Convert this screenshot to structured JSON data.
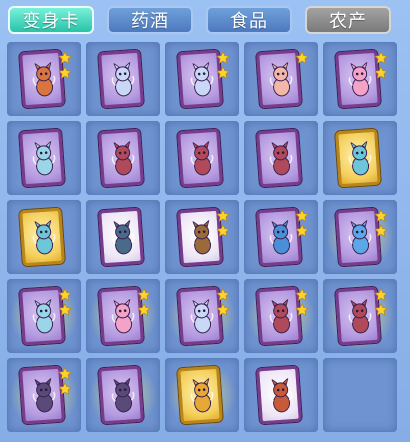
{
  "tabs": [
    {
      "label": "变身卡",
      "state": "active"
    },
    {
      "label": "药酒",
      "state": "inactive"
    },
    {
      "label": "食品",
      "state": "inactive"
    },
    {
      "label": "农产",
      "state": "gray"
    }
  ],
  "colors": {
    "active_tab": "#28c3a8",
    "inactive_tab": "#4d79bf",
    "gray_tab": "#7a7a7a",
    "slot": "#6f93d0",
    "purple_frame": "#7a3b8d",
    "gold_frame": "#b98617",
    "star": "#ffd42a"
  },
  "inventory": [
    {
      "icon": "fox-spirit-card",
      "frame": "purple",
      "stars": 2,
      "glow": false,
      "color": "#d9753f"
    },
    {
      "icon": "white-horse-card",
      "frame": "purple",
      "stars": 0,
      "glow": false,
      "color": "#c9d8f7"
    },
    {
      "icon": "white-horse-card",
      "frame": "purple",
      "stars": 2,
      "glow": false,
      "color": "#c9d8f7"
    },
    {
      "icon": "pig-card",
      "frame": "purple",
      "stars": 1,
      "glow": false,
      "color": "#f2b7a6"
    },
    {
      "icon": "rabbit-spirit-card",
      "frame": "purple",
      "stars": 2,
      "glow": false,
      "color": "#f3a2c8"
    },
    {
      "icon": "fairy-card",
      "frame": "purple",
      "stars": 0,
      "glow": false,
      "color": "#9ad6e8"
    },
    {
      "icon": "bat-demon-card",
      "frame": "purple",
      "stars": 0,
      "glow": false,
      "color": "#b04a5a"
    },
    {
      "icon": "bat-demon-card",
      "frame": "purple",
      "stars": 0,
      "glow": false,
      "color": "#b04a5a"
    },
    {
      "icon": "bat-demon-card",
      "frame": "purple",
      "stars": 0,
      "glow": false,
      "color": "#b04a5a"
    },
    {
      "icon": "fairy-girl-card",
      "frame": "gold",
      "stars": 0,
      "glow": false,
      "color": "#6cc7d8"
    },
    {
      "icon": "fairy-girl-card",
      "frame": "gold",
      "stars": 0,
      "glow": false,
      "color": "#6cc7d8"
    },
    {
      "icon": "armored-warrior-card",
      "frame": "white",
      "stars": 0,
      "glow": false,
      "color": "#4a6a8a"
    },
    {
      "icon": "bear-card",
      "frame": "white",
      "stars": 2,
      "glow": false,
      "color": "#9a6a3a"
    },
    {
      "icon": "mermaid-card",
      "frame": "purple",
      "stars": 2,
      "glow": false,
      "color": "#4a8fd8"
    },
    {
      "icon": "ice-wolf-card",
      "frame": "purple",
      "stars": 2,
      "glow": true,
      "color": "#5aa8e8"
    },
    {
      "icon": "fairy-card",
      "frame": "purple",
      "stars": 2,
      "glow": true,
      "color": "#9ad6e8"
    },
    {
      "icon": "rabbit-spirit-card",
      "frame": "purple",
      "stars": 2,
      "glow": true,
      "color": "#f3a2c8"
    },
    {
      "icon": "white-horse-card",
      "frame": "purple",
      "stars": 2,
      "glow": true,
      "color": "#c9d8f7"
    },
    {
      "icon": "bat-demon-card",
      "frame": "purple",
      "stars": 2,
      "glow": true,
      "color": "#b04a5a"
    },
    {
      "icon": "bat-demon-card",
      "frame": "purple",
      "stars": 2,
      "glow": true,
      "color": "#b04a5a"
    },
    {
      "icon": "ghost-lady-card",
      "frame": "purple",
      "stars": 2,
      "glow": true,
      "color": "#5a4a7a"
    },
    {
      "icon": "ghost-lady-card",
      "frame": "purple",
      "stars": 0,
      "glow": true,
      "color": "#5a4a7a"
    },
    {
      "icon": "golden-deer-card",
      "frame": "gold",
      "stars": 0,
      "glow": true,
      "color": "#e8a838"
    },
    {
      "icon": "old-monk-card",
      "frame": "white",
      "stars": 0,
      "glow": false,
      "color": "#c85a3a"
    },
    {
      "icon": "empty-slot",
      "frame": "none",
      "stars": 0,
      "glow": false,
      "color": ""
    }
  ]
}
